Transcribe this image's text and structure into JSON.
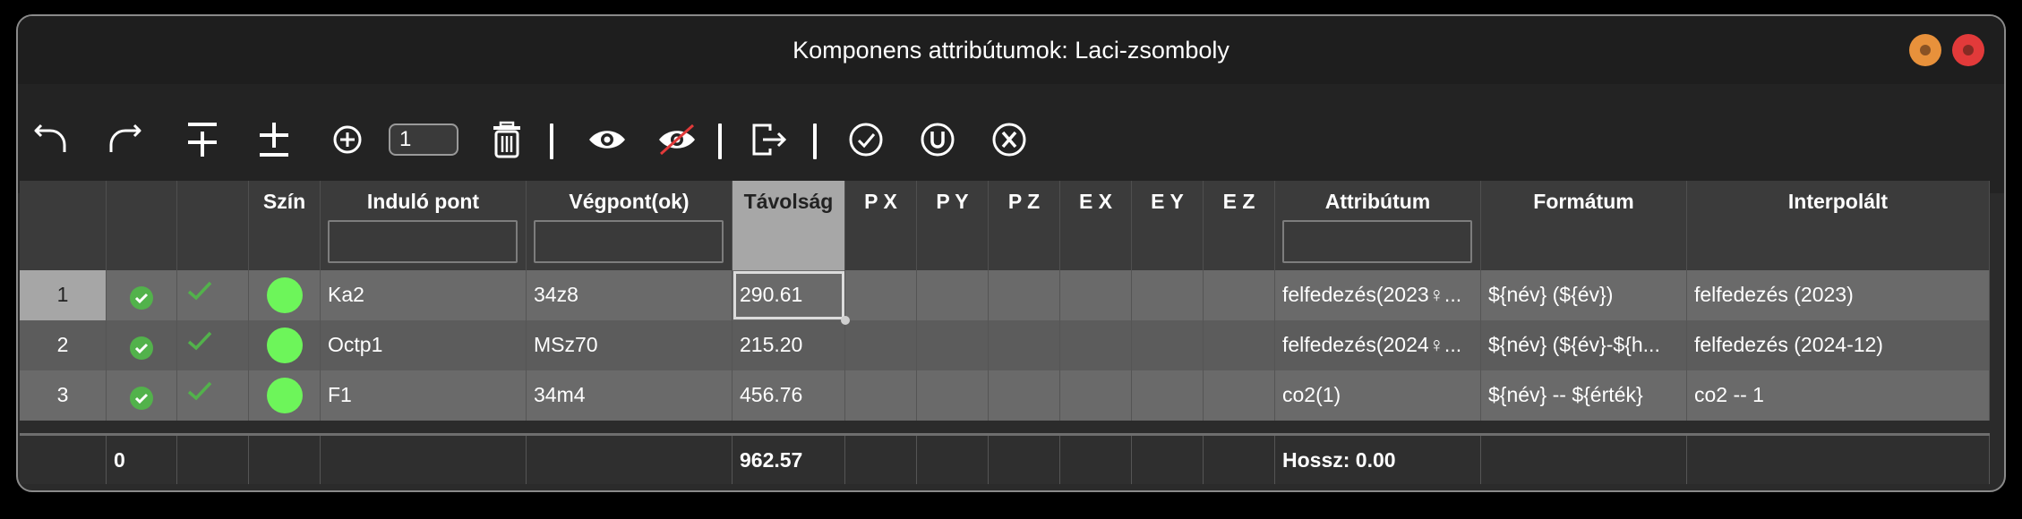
{
  "window": {
    "title": "Komponens attribútumok: Laci-zsomboly"
  },
  "toolbar": {
    "count_value": "1",
    "icons": [
      "undo-icon",
      "redo-icon",
      "insert-above-icon",
      "insert-below-icon",
      "add-circle-icon",
      "trash-icon",
      "eye-icon",
      "eye-off-icon",
      "export-icon",
      "check-circle-icon",
      "u-circle-icon",
      "x-circle-icon"
    ]
  },
  "columns": {
    "szin": "Szín",
    "indulo": "Induló pont",
    "vegpont": "Végpont(ok)",
    "tavolsag": "Távolság",
    "px": "P X",
    "py": "P Y",
    "pz": "P Z",
    "ex": "E X",
    "ey": "E Y",
    "ez": "E Z",
    "attributum": "Attribútum",
    "formatum": "Formátum",
    "interpolalt": "Interpolált"
  },
  "rows": [
    {
      "num": "1",
      "indulo": "Ka2",
      "vegpont": "34z8",
      "tavolsag": "290.61",
      "attributum": "felfedezés(2023♀...",
      "formatum": "${név} (${év})",
      "interpolalt": "felfedezés (2023)"
    },
    {
      "num": "2",
      "indulo": "Octp1",
      "vegpont": "MSz70",
      "tavolsag": "215.20",
      "attributum": "felfedezés(2024♀...",
      "formatum": "${név} (${év}-${h...",
      "interpolalt": "felfedezés (2024-12)"
    },
    {
      "num": "3",
      "indulo": "F1",
      "vegpont": "34m4",
      "tavolsag": "456.76",
      "attributum": "co2(1)",
      "formatum": "${név} -- ${érték}",
      "interpolalt": "co2 -- 1"
    }
  ],
  "footer": {
    "count": "0",
    "total": "962.57",
    "length": "Hossz: 0.00"
  },
  "colors": {
    "dot": "#6df55a",
    "check": "#52b24b",
    "close": "#e23a3a",
    "minimize": "#e8913b"
  }
}
